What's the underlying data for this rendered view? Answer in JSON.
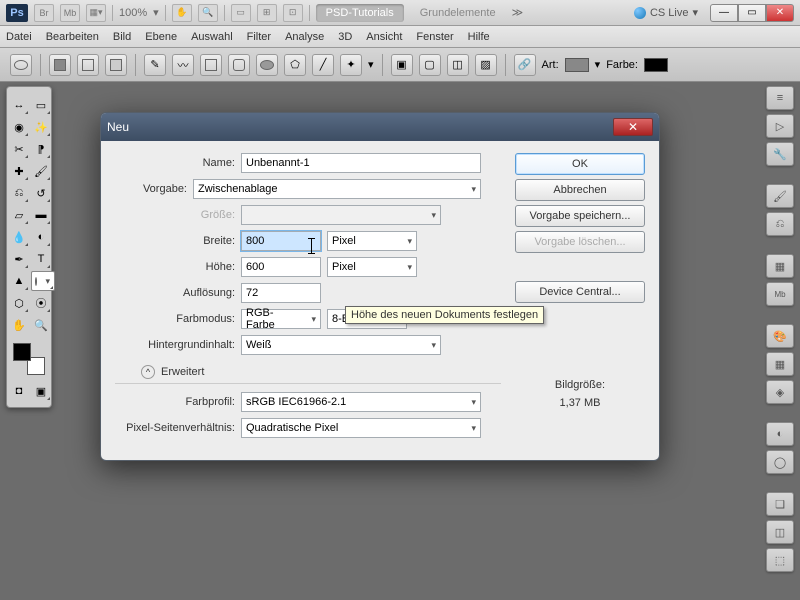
{
  "topbar": {
    "ps": "Ps",
    "br": "Br",
    "mb": "Mb",
    "zoom": "100%",
    "workspace_active": "PSD-Tutorials",
    "workspace_inactive": "Grundelemente",
    "more": "≫",
    "cslive": "CS Live"
  },
  "menu": [
    "Datei",
    "Bearbeiten",
    "Bild",
    "Ebene",
    "Auswahl",
    "Filter",
    "Analyse",
    "3D",
    "Ansicht",
    "Fenster",
    "Hilfe"
  ],
  "options": {
    "art": "Art:",
    "farbe": "Farbe:"
  },
  "dialog": {
    "title": "Neu",
    "labels": {
      "name": "Name:",
      "vorgabe": "Vorgabe:",
      "groesse": "Größe:",
      "breite": "Breite:",
      "hoehe": "Höhe:",
      "aufloesung": "Auflösung:",
      "farbmodus": "Farbmodus:",
      "hintergrund": "Hintergrundinhalt:",
      "erweitert": "Erweitert",
      "farbprofil": "Farbprofil:",
      "pixelsv": "Pixel-Seitenverhältnis:"
    },
    "values": {
      "name": "Unbenannt-1",
      "vorgabe": "Zwischenablage",
      "breite": "800",
      "hoehe": "600",
      "aufloesung": "72",
      "unit_px": "Pixel",
      "farbmodus": "RGB-Farbe",
      "bits": "8-Bit",
      "hintergrund": "Weiß",
      "farbprofil": "sRGB IEC61966-2.1",
      "pixelsv": "Quadratische Pixel"
    },
    "buttons": {
      "ok": "OK",
      "abbrechen": "Abbrechen",
      "save": "Vorgabe speichern...",
      "delete": "Vorgabe löschen...",
      "device": "Device Central..."
    },
    "size_label": "Bildgröße:",
    "size_value": "1,37 MB",
    "tooltip": "Höhe des neuen Dokuments festlegen"
  }
}
